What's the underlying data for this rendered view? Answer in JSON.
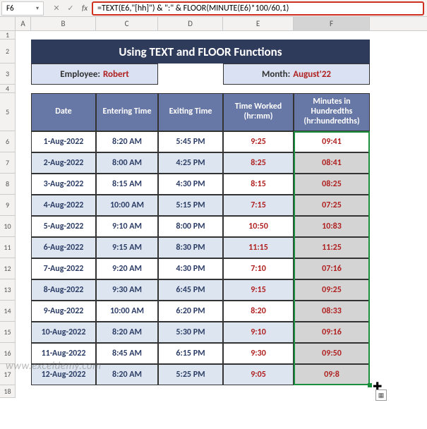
{
  "namebox": "F6",
  "formula": "=TEXT(E6,\"[hh]\") & \":\" & FLOOR(MINUTE(E6)*100/60,1)",
  "columns": [
    "A",
    "B",
    "C",
    "D",
    "E",
    "F"
  ],
  "title": "Using TEXT and FLOOR Functions",
  "employee": {
    "label": "Employee:",
    "value": "Robert"
  },
  "month": {
    "label": "Month:",
    "value": "August'22"
  },
  "headers": {
    "b": "Date",
    "c": "Entering Time",
    "d": "Exiting Time",
    "e": "Time Worked (hr:mm)",
    "f": "Minutes in Hundredths (hr:hundredths)"
  },
  "rows": [
    {
      "n": "6",
      "date": "1-Aug-2022",
      "in": "8:20 AM",
      "out": "5:45 PM",
      "worked": "9:25",
      "hund": "09:41"
    },
    {
      "n": "7",
      "date": "2-Aug-2022",
      "in": "8:00 AM",
      "out": "4:25 PM",
      "worked": "8:25",
      "hund": "08:41"
    },
    {
      "n": "8",
      "date": "3-Aug-2022",
      "in": "8:15 AM",
      "out": "4:30 PM",
      "worked": "8:15",
      "hund": "08:25"
    },
    {
      "n": "9",
      "date": "4-Aug-2022",
      "in": "10:00 AM",
      "out": "5:15 PM",
      "worked": "7:15",
      "hund": "07:25"
    },
    {
      "n": "10",
      "date": "5-Aug-2022",
      "in": "9:10 AM",
      "out": "8:00 PM",
      "worked": "10:50",
      "hund": "10:83"
    },
    {
      "n": "11",
      "date": "6-Aug-2022",
      "in": "9:15 AM",
      "out": "8:30 PM",
      "worked": "11:15",
      "hund": "11:25"
    },
    {
      "n": "12",
      "date": "7-Aug-2022",
      "in": "9:20 AM",
      "out": "4:30 PM",
      "worked": "7:10",
      "hund": "07:16"
    },
    {
      "n": "13",
      "date": "8-Aug-2022",
      "in": "9:30 AM",
      "out": "6:45 PM",
      "worked": "9:15",
      "hund": "09:25"
    },
    {
      "n": "14",
      "date": "9-Aug-2022",
      "in": "10:00 AM",
      "out": "6:20 PM",
      "worked": "8:20",
      "hund": "08:33"
    },
    {
      "n": "15",
      "date": "10-Aug-2022",
      "in": "8:20 AM",
      "out": "5:30 PM",
      "worked": "9:10",
      "hund": "09:16"
    },
    {
      "n": "16",
      "date": "11-Aug-2022",
      "in": "8:45 AM",
      "out": "6:15 PM",
      "worked": "9:30",
      "hund": "09:50"
    },
    {
      "n": "17",
      "date": "12-Aug-2022",
      "in": "8:20 AM",
      "out": "5:25 PM",
      "worked": "9:05",
      "hund": "09:8"
    }
  ],
  "row_before": [
    "1",
    "2",
    "3",
    "4",
    "5"
  ],
  "last_row": "18",
  "icons": {
    "down": "▾",
    "cancel": "✕",
    "enter": "✓",
    "fx": "fx",
    "cross": "✚",
    "fill": "▦"
  },
  "watermark": "www.exceldemy.com"
}
